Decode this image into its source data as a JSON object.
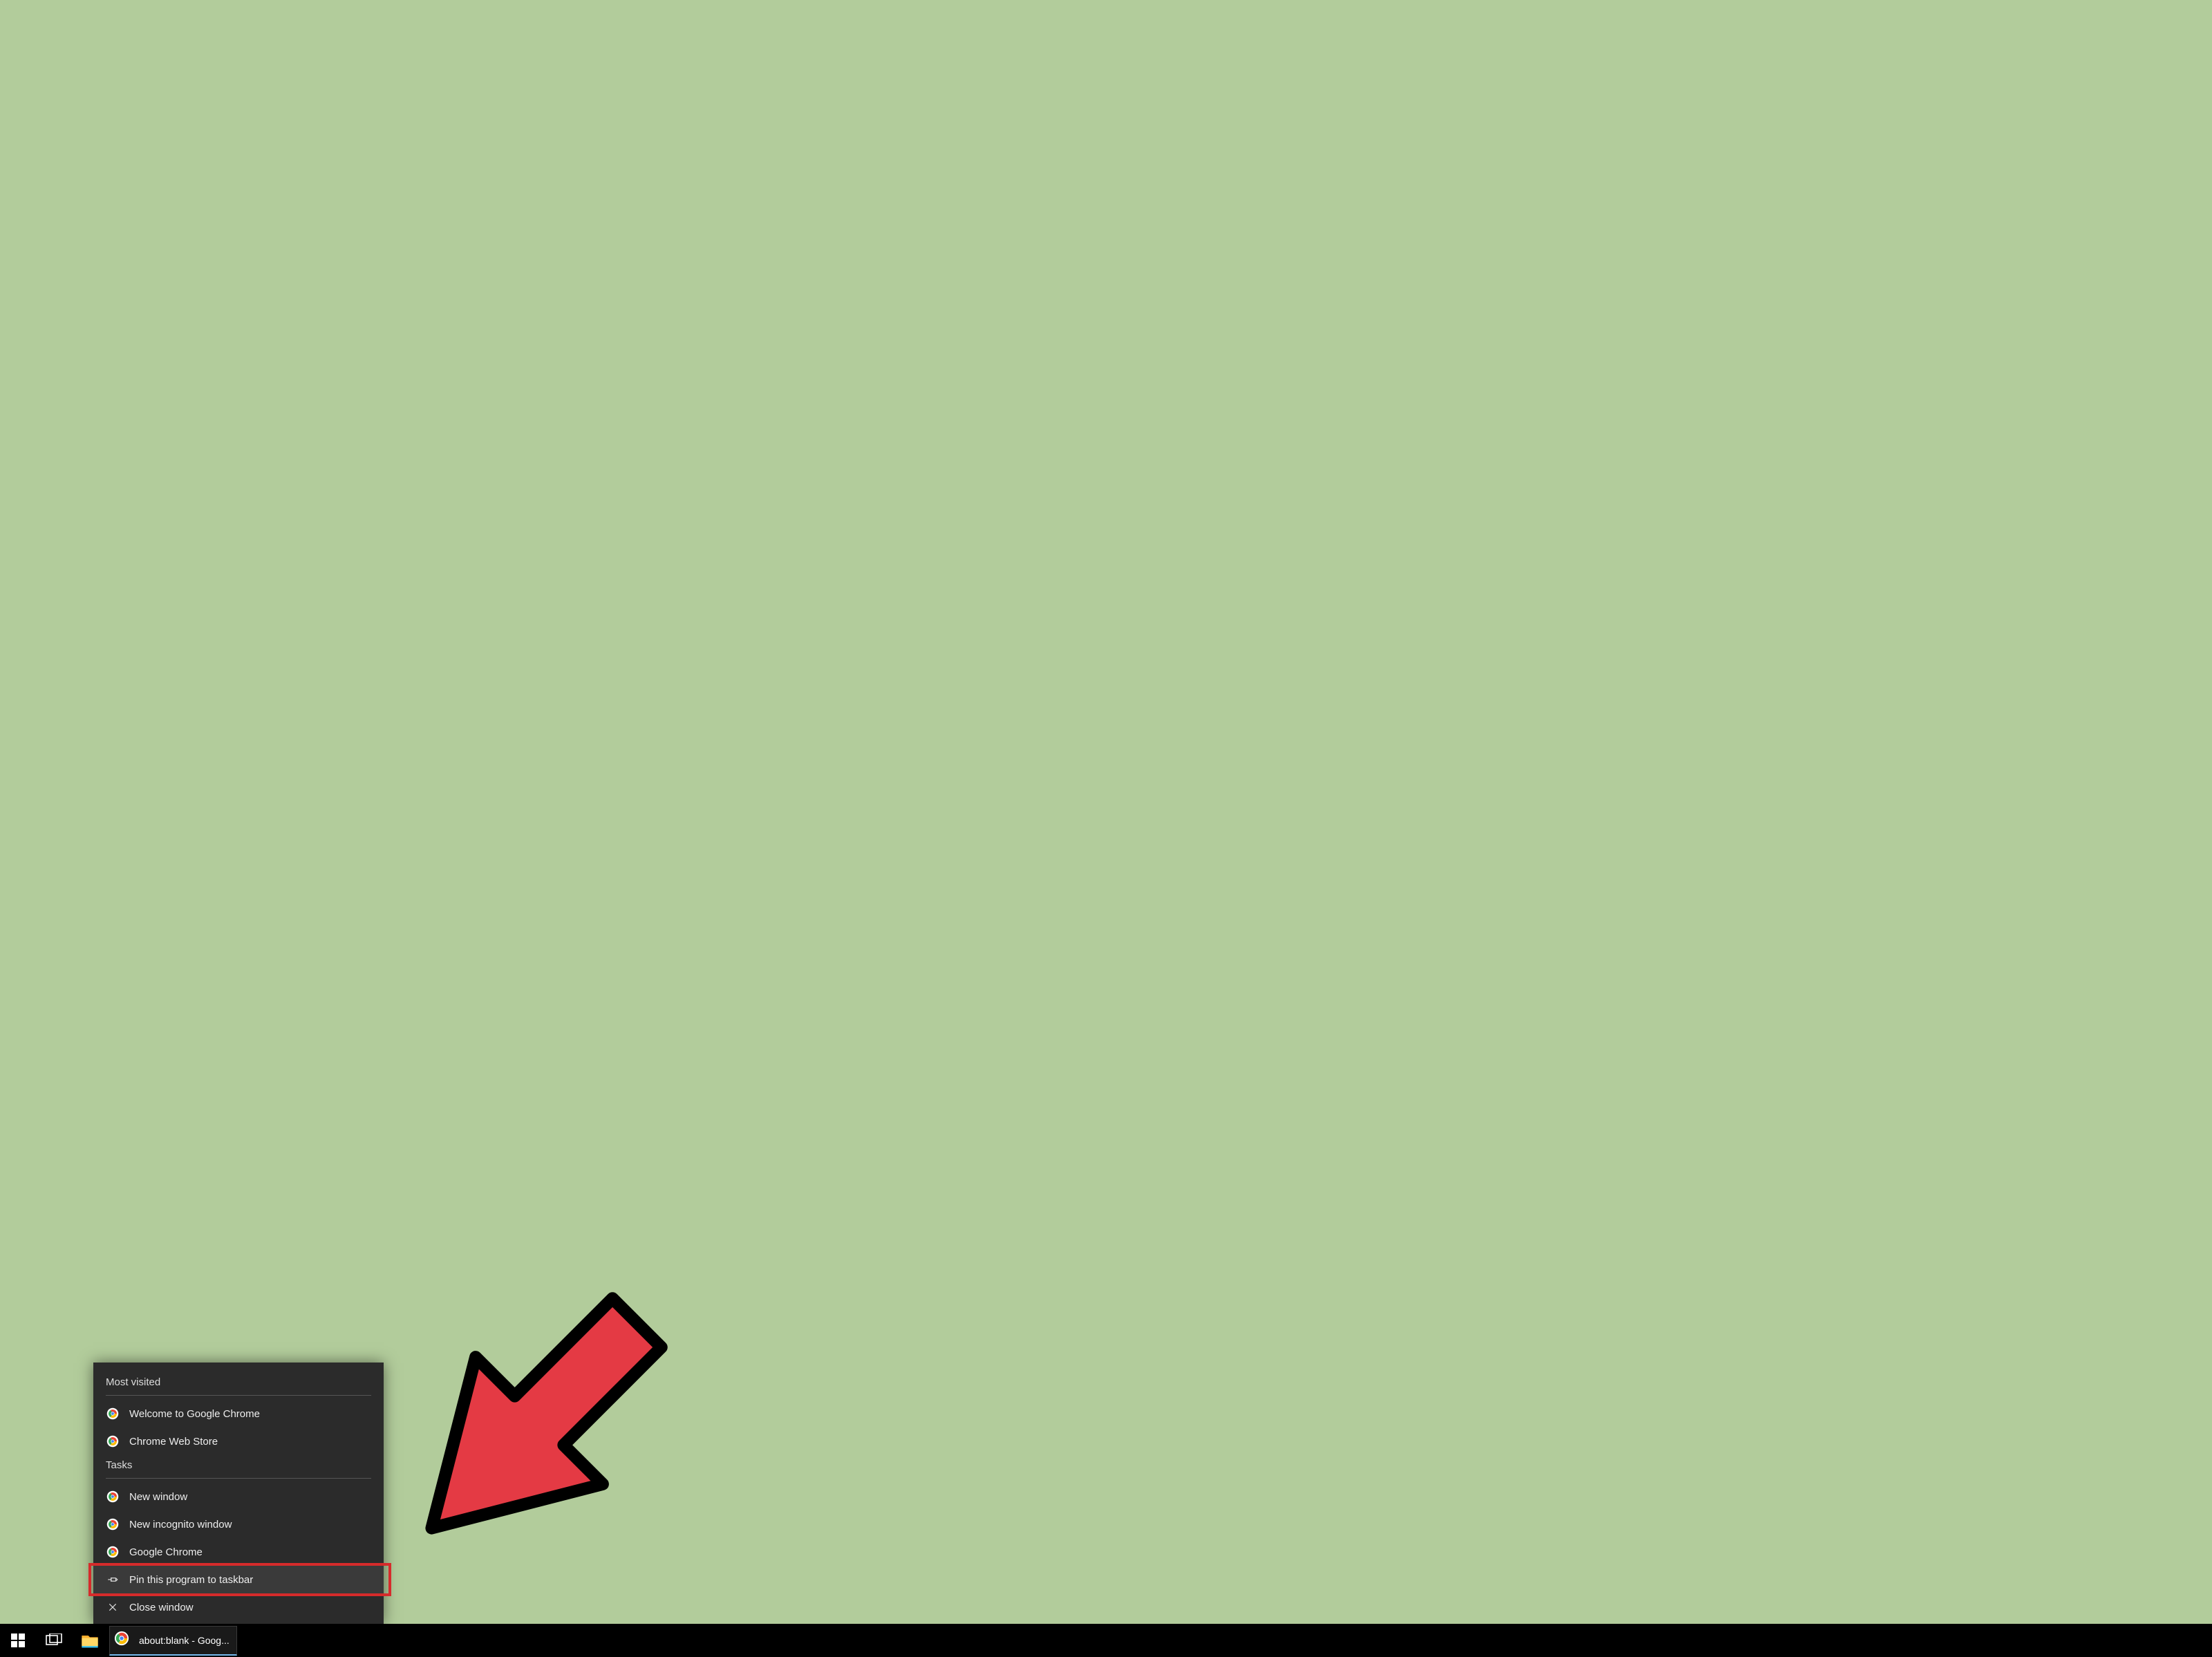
{
  "jumplist": {
    "sections": {
      "most_visited_label": "Most visited",
      "tasks_label": "Tasks"
    },
    "most_visited": [
      {
        "label": "Welcome to Google Chrome"
      },
      {
        "label": "Chrome Web Store"
      }
    ],
    "tasks": [
      {
        "label": "New window"
      },
      {
        "label": "New incognito window"
      }
    ],
    "app_item_label": "Google Chrome",
    "pin_item_label": "Pin this program to taskbar",
    "close_item_label": "Close window"
  },
  "taskbar": {
    "running_task_label": "about:blank - Goog..."
  }
}
